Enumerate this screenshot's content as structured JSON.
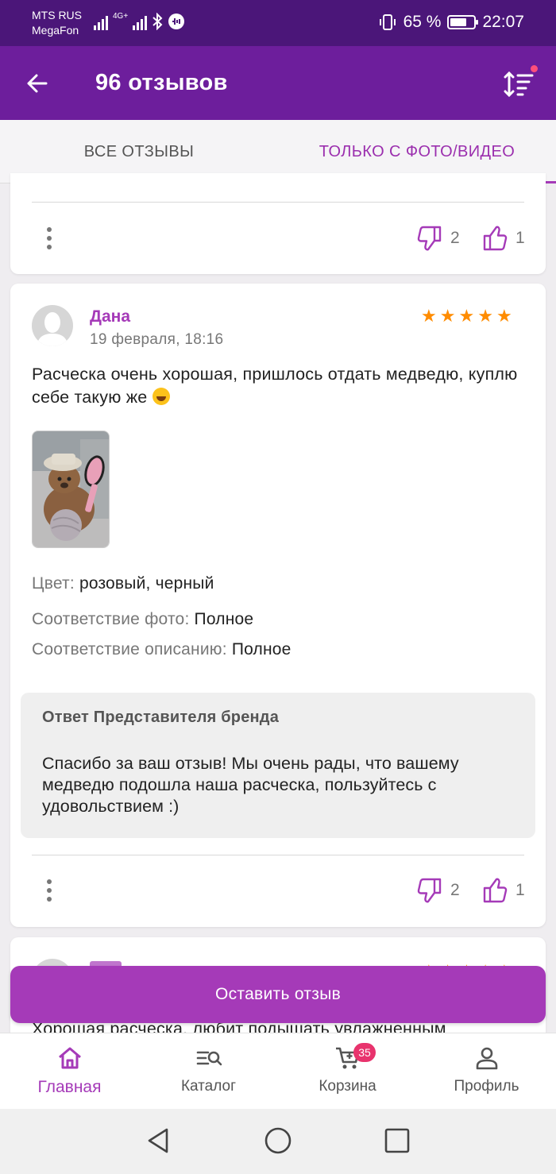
{
  "status_bar": {
    "carrier_1": "MTS RUS",
    "carrier_2": "MegaFon",
    "network": "4G+",
    "battery": "65 %",
    "time": "22:07"
  },
  "header": {
    "title": "96 отзывов"
  },
  "tabs": [
    {
      "label": "ВСЕ ОТЗЫВЫ",
      "active": false
    },
    {
      "label": "ТОЛЬКО С ФОТО/ВИДЕО",
      "active": true
    }
  ],
  "previous_review": {
    "dislikes": "2",
    "likes": "1"
  },
  "review": {
    "author": "Дана",
    "date": "19 февраля, 18:16",
    "rating": 5,
    "text": "Расческа очень хорошая, пришлось отдать медведю, куплю себе такую же",
    "attributes": [
      {
        "label": "Цвет:",
        "value": "розовый, черный"
      },
      {
        "label": "Соответствие фото:",
        "value": "Полное"
      },
      {
        "label": "Соответствие описанию:",
        "value": "Полное"
      }
    ],
    "brand_reply": {
      "title": "Ответ Представителя бренда",
      "text": "Спасибо за ваш отзыв! Мы очень рады, что вашему медведю подошла наша расческа, пользуйтесь с удовольствием :)"
    },
    "dislikes": "2",
    "likes": "1"
  },
  "next_review": {
    "text_partial": "Хорошая расческа, любит подышать увлажненным"
  },
  "leave_review_button": "Оставить отзыв",
  "bottom_nav": {
    "items": [
      {
        "label": "Главная",
        "icon": "home-icon",
        "active": true
      },
      {
        "label": "Каталог",
        "icon": "catalog-search-icon",
        "active": false
      },
      {
        "label": "Корзина",
        "icon": "cart-icon",
        "active": false,
        "badge": "35"
      },
      {
        "label": "Профиль",
        "icon": "profile-icon",
        "active": false
      }
    ]
  },
  "colors": {
    "status_bar": "#4b1679",
    "app_bar": "#6d1e9c",
    "accent": "#a53ab8",
    "stars": "#ff8c00",
    "badge": "#e8336d"
  }
}
